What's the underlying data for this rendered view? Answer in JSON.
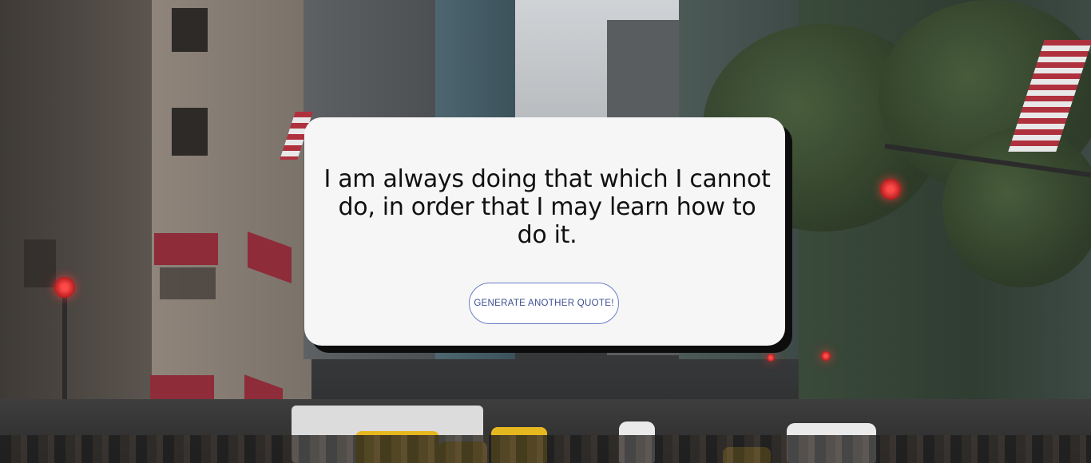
{
  "quote": {
    "text": "I am always doing that which I cannot do, in order that I may learn how to do it."
  },
  "actions": {
    "generate_label": "GENERATE ANOTHER QUOTE!"
  },
  "colors": {
    "card_background": "#f6f6f6",
    "card_shadow": "#0d0d0d",
    "button_border": "#6b7fc7",
    "button_text": "#3d4f91"
  }
}
